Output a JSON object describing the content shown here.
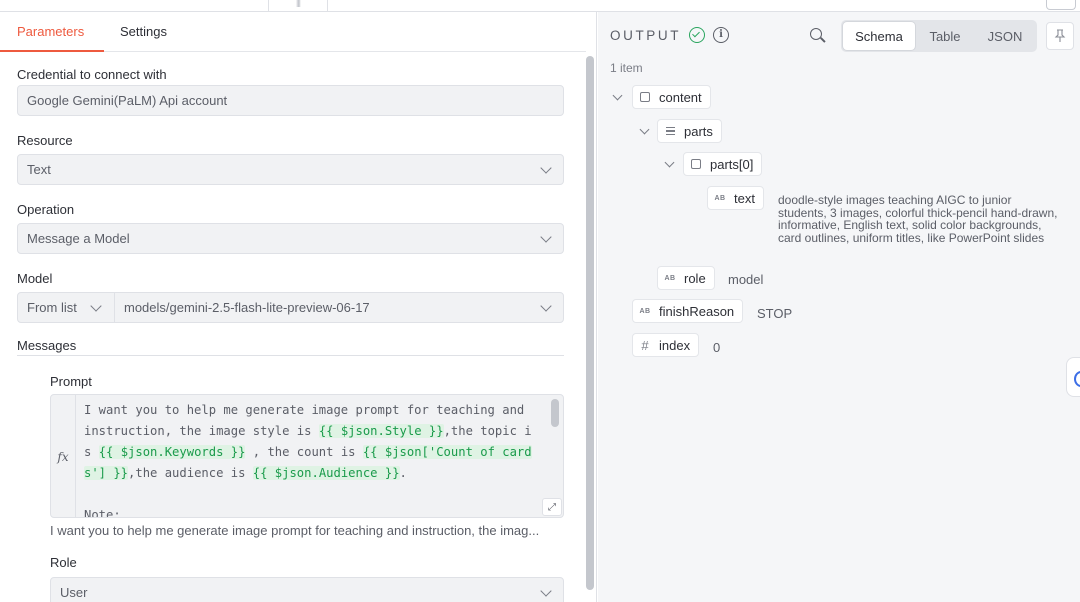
{
  "tabs": {
    "parameters": "Parameters",
    "settings": "Settings"
  },
  "credential": {
    "label": "Credential to connect with",
    "value": "Google Gemini(PaLM) Api account"
  },
  "resource": {
    "label": "Resource",
    "value": "Text"
  },
  "operation": {
    "label": "Operation",
    "value": "Message a Model"
  },
  "model": {
    "label": "Model",
    "mode": "From list",
    "value": "models/gemini-2.5-flash-lite-preview-06-17"
  },
  "messages": {
    "label": "Messages",
    "prompt_label": "Prompt",
    "prompt_lines": [
      [
        "I want you to help me generate image prompt for teaching and"
      ],
      [
        "instruction, the image style is ",
        "{{ $json.Style }}",
        ",the topic i"
      ],
      [
        "s ",
        "{{ $json.Keywords }}",
        " , the count is ",
        "{{ $json['Count of card"
      ],
      [
        "s'] }}",
        ",the audience is ",
        "{{ $json.Audience }}",
        "."
      ],
      [
        ""
      ],
      [
        "Note:"
      ]
    ],
    "prompt_preview": "I want you to help me generate image prompt for teaching and instruction, the imag...",
    "role_label": "Role",
    "role_value": "User"
  },
  "output": {
    "title": "OUTPUT",
    "views": {
      "schema": "Schema",
      "table": "Table",
      "json": "JSON"
    },
    "active_view": "Schema",
    "item_count": "1 item",
    "tree": {
      "content": "content",
      "parts": "parts",
      "parts0": "parts[0]",
      "text_key": "text",
      "text_value": "doodle-style images teaching AIGC to junior students, 3 images, colorful thick-pencil hand-drawn, informative, English text, solid color backgrounds, card outlines, uniform titles, like PowerPoint slides",
      "role_key": "role",
      "role_value": "model",
      "finish_key": "finishReason",
      "finish_value": "STOP",
      "index_key": "index",
      "index_value": "0"
    }
  },
  "icons": {
    "success": "check-circle-icon",
    "info": "info-icon",
    "search": "search-icon",
    "pin": "pin-icon",
    "object": "cube-icon",
    "array": "list-icon",
    "string": "AB",
    "number": "#",
    "expression": "fx"
  },
  "colors": {
    "accent": "#ee5a3f",
    "success": "#2aa55f",
    "expression": "#1a9b4b",
    "expression_bg": "#dff3e4"
  }
}
